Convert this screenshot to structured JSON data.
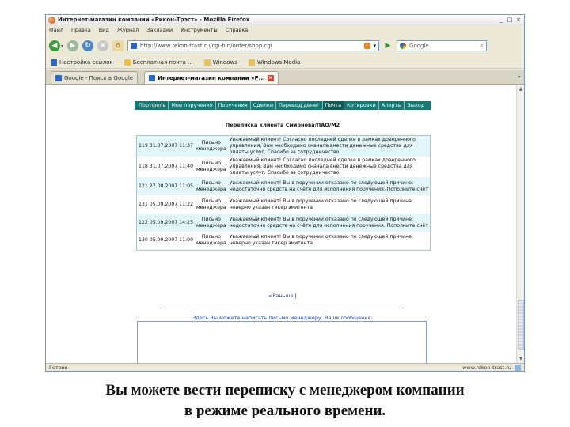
{
  "window": {
    "title": "Интернет-магазин компании «Рикон-Трэст» - Mozilla Firefox",
    "controls": {
      "minimize": "_",
      "maximize": "□",
      "close": "×"
    }
  },
  "menubar": [
    "Файл",
    "Правка",
    "Вид",
    "Журнал",
    "Закладки",
    "Инструменты",
    "Справка"
  ],
  "navbar": {
    "url": "http://www.rekon-trast.ru/cgi-bin/order/shop.cgi",
    "search_text": "Google"
  },
  "bookmarks": [
    {
      "label": "Настройка ссылок",
      "icon": "page-icon"
    },
    {
      "label": "Бесплатная почта ...",
      "icon": "star-icon"
    },
    {
      "label": "Windows",
      "icon": "folder-icon"
    },
    {
      "label": "Windows Media",
      "icon": "folder-icon"
    }
  ],
  "tabs": [
    {
      "label": "Google - Поиск в Google",
      "active": false
    },
    {
      "label": "Интернет-магазин компании «Р...",
      "active": true
    }
  ],
  "site_nav": [
    {
      "label": "Портфель",
      "active": false
    },
    {
      "label": "Мои поручения",
      "active": false
    },
    {
      "label": "Поручения",
      "active": false
    },
    {
      "label": "Сделки",
      "active": false
    },
    {
      "label": "Перевод денег",
      "active": false
    },
    {
      "label": "Почта",
      "active": true
    },
    {
      "label": "Котировки",
      "active": false
    },
    {
      "label": "Алерты",
      "active": false
    },
    {
      "label": "Выход",
      "active": false
    }
  ],
  "heading": "Переписка клиента Смирнова/ПАО/М2",
  "messages": [
    {
      "num": "119",
      "date": "31.07.2007 11:37",
      "sender": "Письмо менеджера",
      "text": "Уважаемый клиент! Согласно последней сделке в рамках доверенного управления, Вам необходимо сначала внести денежные средства для оплаты услуг. Спасибо за сотрудничество",
      "row_style": "cyan"
    },
    {
      "num": "118",
      "date": "31.07.2007 11:40",
      "sender": "Письмо менеджера",
      "text": "Уважаемый клиент! Согласно последней сделке в рамках доверенного управления, Вам необходимо сначала внести денежные средства для оплаты услуг. Спасибо за сотрудничество",
      "row_style": "white"
    },
    {
      "num": "121",
      "date": "27.08.2007 11:05",
      "sender": "Письмо менеджера",
      "text": "Уважаемый клиент! Вы в поручении отказано по следующей причине: недостаточно средств на счёте для исполнения поручения. Пополните счёт",
      "row_style": "cyan"
    },
    {
      "num": "131",
      "date": "05.09.2007 11:22",
      "sender": "Письмо менеджера",
      "text": "Уважаемый клиент! Вы в поручении отказано по следующей причине: неверно указан тикер эмитента",
      "row_style": "white"
    },
    {
      "num": "122",
      "date": "05.09.2007 14:25",
      "sender": "Письмо менеджера",
      "text": "Уважаемый клиент! Вы в поручении отказано по следующей причине: недостаточно средств на счёте для исполнения поручения. Пополните счёт",
      "row_style": "cyan"
    },
    {
      "num": "130",
      "date": "05.09.2007 11:00",
      "sender": "Письмо менеджера",
      "text": "Уважаемый клиент! Вы в поручении отказано по следующей причине: неверно указан тикер эмитента",
      "row_style": "white"
    }
  ],
  "pager": {
    "first_label": "<Раньше",
    "separator": "|"
  },
  "compose": {
    "prompt": "Здесь Вы можете написать письмо менеджеру. Ваше сообщение:",
    "value": ""
  },
  "statusbar": {
    "status": "Готово",
    "host": "www.rekon-trast.ru"
  },
  "caption": {
    "line1": "Вы можете вести переписку с менеджером компании",
    "line2": "в режиме реального времени."
  },
  "colors": {
    "nav_bg": "#117b73",
    "row_alt": "#e3f7fa",
    "link": "#1a3fa8"
  }
}
